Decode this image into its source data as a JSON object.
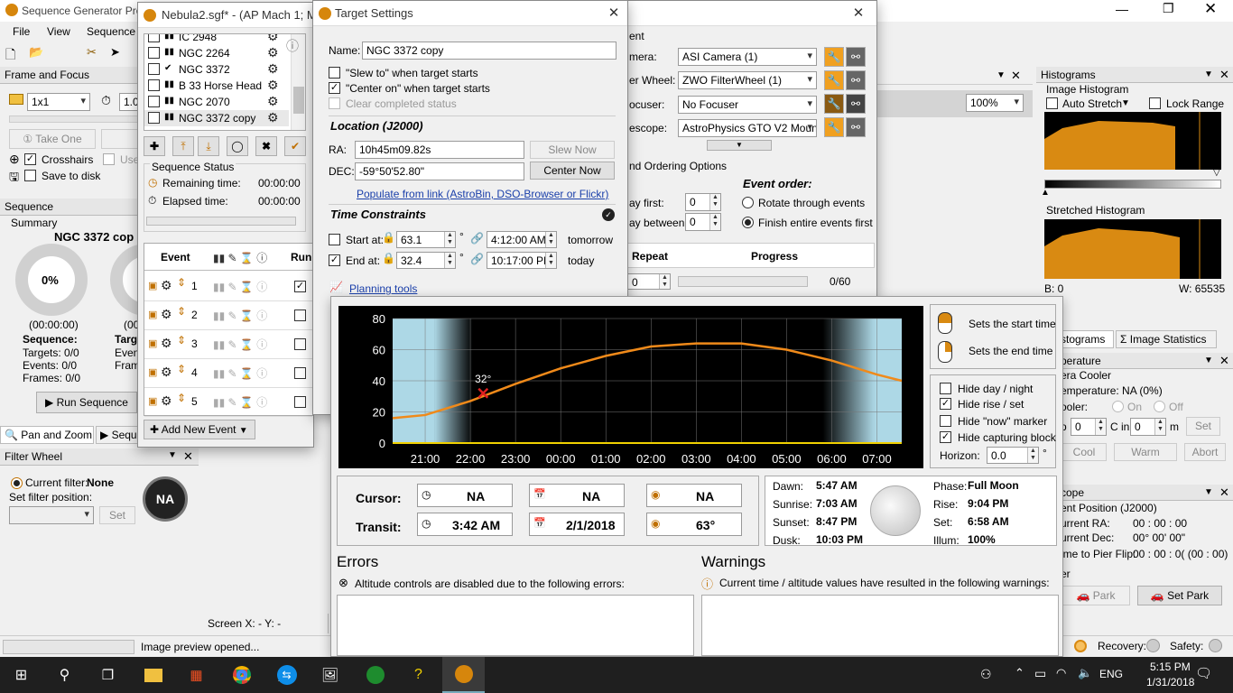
{
  "main": {
    "title": "Sequence Generator Pro",
    "menu": [
      "File",
      "View",
      "Sequence"
    ],
    "frame_focus": {
      "title": "Frame and Focus",
      "binning": "1x1",
      "exposure": "1.0",
      "take_one": "Take One",
      "use": "Use",
      "crosshairs": "Crosshairs",
      "save_to_disk": "Save to disk"
    },
    "sequence_panel": {
      "title": "Sequence",
      "summary": "Summary",
      "target": "NGC 3372 cop",
      "percent": "0%",
      "time": "(00:00:00)",
      "time2": "(00",
      "seq_label": "Sequence:",
      "targ_label": "Targ",
      "targets": "Targets:  0/0",
      "events": "Events:   0/0",
      "frames": "Frames:   0/0",
      "even": "Even",
      "frame": "Fram",
      "run_sequence": "Run Sequence"
    },
    "tabs": {
      "pan_zoom": "Pan and Zoom",
      "seq": "Sequ"
    },
    "filter_wheel": {
      "title": "Filter Wheel",
      "current_label": "Current filter:",
      "current": "None",
      "set_label": "Set filter position:",
      "set_btn": "Set",
      "na": "NA"
    },
    "screen_xy": "Screen X: - Y: -",
    "status": "Image preview opened...",
    "histograms": {
      "title": "Histograms",
      "image": "Image Histogram",
      "auto_stretch": "Auto Stretch",
      "lock_range": "Lock Range",
      "stretched": "Stretched Histogram",
      "b": "B: 0",
      "w": "W: 65535",
      "zoom": "100%",
      "tab1": "stograms",
      "tab2": "Image Statistics"
    },
    "temperature": {
      "title": "perature",
      "cooler": "era Cooler",
      "temp": "emperature: NA (0%)",
      "cooler2": "ooler:",
      "on": "On",
      "off": "Off",
      "p": "p",
      "val1": "0",
      "c_in": "C in",
      "val2": "0",
      "m": "m",
      "set": "Set",
      "cool": "Cool",
      "warm": "Warm",
      "abort": "Abort"
    },
    "scope": {
      "title": "cope",
      "pos": "ent Position (J2000)",
      "ra_l": "urrent RA:",
      "ra": "00 : 00 : 00",
      "dec_l": "urrent Dec:",
      "dec": "00° 00' 00\"",
      "flip_l": "ime to Pier Flip:",
      "flip": "00 : 00 : 0( (00 : 00)",
      "er": "er",
      "park": "Park",
      "set_park": "Set Park",
      "recovery": "Recovery:",
      "safety": "Safety:"
    }
  },
  "nebula": {
    "title": "Nebula2.sgf* - (AP Mach 1; MF",
    "targets": [
      {
        "name": "IC 2948",
        "checked": true,
        "tag": "▮▮"
      },
      {
        "name": "NGC 2264",
        "checked": false,
        "tag": "▮▮"
      },
      {
        "name": "NGC 3372",
        "checked": true,
        "tag": "✔"
      },
      {
        "name": "B 33 Horse Head",
        "checked": false,
        "tag": "▮▮"
      },
      {
        "name": "NGC 2070",
        "checked": false,
        "tag": "▮▮"
      },
      {
        "name": "NGC 3372 copy",
        "checked": false,
        "tag": "▮▮"
      }
    ],
    "status_title": "Sequence Status",
    "remaining_l": "Remaining time:",
    "remaining": "00:00:00",
    "elapsed_l": "Elapsed time:",
    "elapsed": "00:00:00",
    "col_event": "Event",
    "col_run": "Run",
    "event_rows": [
      "1",
      "2",
      "3",
      "4",
      "5"
    ],
    "add_event": "Add New Event"
  },
  "back": {
    "ent": "ent",
    "mera": "mera:",
    "camera": "ASI Camera (1)",
    "wheel_l": "er Wheel:",
    "wheel": "ZWO FilterWheel (1)",
    "focuser_l": "ocuser:",
    "focuser": "No Focuser",
    "scope_l": "escope:",
    "scope": "AstroPhysics GTO V2 Moun",
    "ordering": "nd Ordering Options",
    "event_order": "Event order:",
    "first_l": "ay first:",
    "first": "0",
    "between_l": "ay between:",
    "between": "0",
    "rotate": "Rotate through events",
    "finish": "Finish entire events first",
    "repeat": "Repeat",
    "progress": "Progress",
    "repeat_val": "0",
    "progress_val": "0/60"
  },
  "target_settings": {
    "title": "Target Settings",
    "name_l": "Name:",
    "name": "NGC 3372 copy",
    "slew_to": "\"Slew to\" when target starts",
    "center_on": "\"Center on\" when target starts",
    "clear": "Clear completed status",
    "location": "Location (J2000)",
    "ra_l": "RA:",
    "ra": "10h45m09.82s",
    "dec_l": "DEC:",
    "dec": "-59°50'52.80\"",
    "slew_now": "Slew Now",
    "center_now": "Center Now",
    "populate": "Populate from link (AstroBin, DSO-Browser or Flickr)",
    "time_constraints": "Time Constraints",
    "start_l": "Start at:",
    "start_alt": "63.1",
    "start_time": "4:12:00 AM",
    "start_when": "tomorrow",
    "end_l": "End at:",
    "end_alt": "32.4",
    "end_time": "10:17:00 PM",
    "end_when": "today",
    "planning": "Planning tools"
  },
  "planning": {
    "chart_data": {
      "type": "line",
      "x": [
        "21:00",
        "22:00",
        "23:00",
        "00:00",
        "01:00",
        "02:00",
        "03:00",
        "04:00",
        "05:00",
        "06:00",
        "07:00"
      ],
      "xlabel": "",
      "ylabel": "",
      "ylim": [
        0,
        80
      ],
      "yticks": [
        0,
        20,
        40,
        60,
        80
      ],
      "series": [
        {
          "values": [
            18,
            27,
            38,
            48,
            56,
            62,
            64,
            64,
            60,
            53,
            44
          ]
        }
      ],
      "marker": {
        "x": "22:17",
        "y": 32,
        "label": "32°"
      }
    },
    "sets_start": "Sets the start time",
    "sets_end": "Sets the end time",
    "hide_day": "Hide day / night",
    "hide_rise": "Hide rise / set",
    "hide_now": "Hide \"now\" marker",
    "hide_block": "Hide capturing block",
    "horizon_l": "Horizon:",
    "horizon": "0.0",
    "horizon_unit": "°",
    "cursor_l": "Cursor:",
    "cursor_time": "NA",
    "cursor_date": "NA",
    "cursor_alt": "NA",
    "transit_l": "Transit:",
    "transit_time": "3:42 AM",
    "transit_date": "2/1/2018",
    "transit_alt": "63°",
    "dawn_l": "Dawn:",
    "dawn": "5:47 AM",
    "sunrise_l": "Sunrise:",
    "sunrise": "7:03 AM",
    "sunset_l": "Sunset:",
    "sunset": "8:47 PM",
    "dusk_l": "Dusk:",
    "dusk": "10:03 PM",
    "phase_l": "Phase:",
    "phase": "Full Moon",
    "rise_l": "Rise:",
    "rise": "9:04 PM",
    "set_l": "Set:",
    "set": "6:58 AM",
    "illum_l": "Illum:",
    "illum": "100%",
    "errors": "Errors",
    "errors_msg": "Altitude controls are disabled due to the following errors:",
    "warnings": "Warnings",
    "warnings_msg": "Current time / altitude values have resulted in the following warnings:"
  },
  "taskbar": {
    "lang": "ENG",
    "time": "5:15 PM",
    "date": "1/31/2018"
  }
}
